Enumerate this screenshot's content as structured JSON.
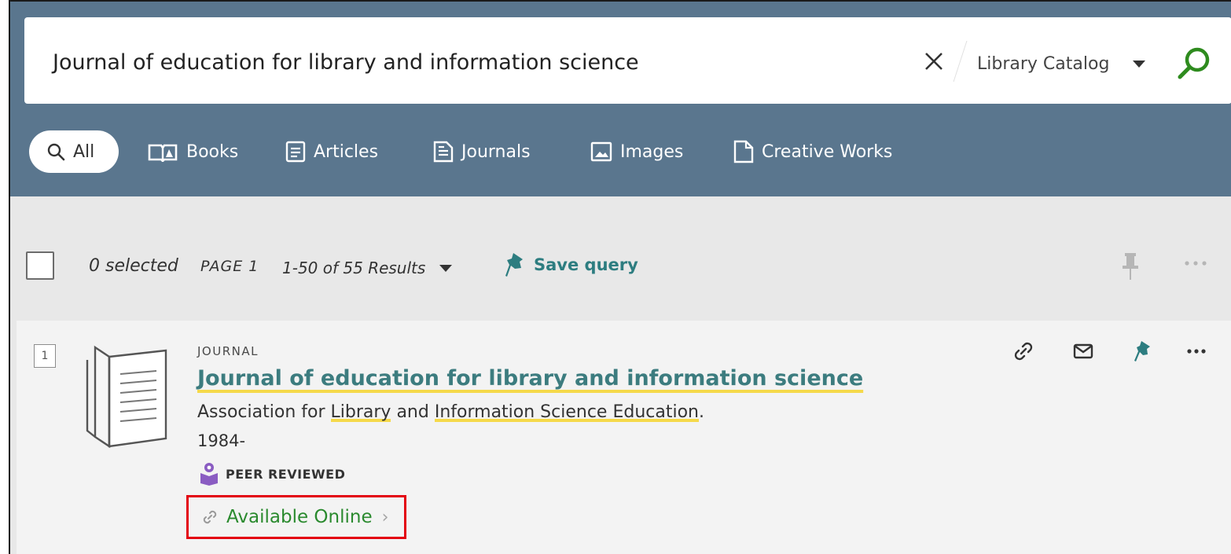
{
  "search": {
    "query": "Journal of education for library and information science",
    "scope": "Library Catalog"
  },
  "tabs": [
    {
      "label": "All",
      "icon": "search-icon"
    },
    {
      "label": "Books",
      "icon": "open-book-icon"
    },
    {
      "label": "Articles",
      "icon": "article-icon"
    },
    {
      "label": "Journals",
      "icon": "journal-icon"
    },
    {
      "label": "Images",
      "icon": "image-icon"
    },
    {
      "label": "Creative Works",
      "icon": "document-icon"
    }
  ],
  "toolbar": {
    "selected": "0 selected",
    "page": "PAGE 1",
    "results": "1-50 of 55 Results",
    "save_query": "Save query"
  },
  "result": {
    "index": "1",
    "type": "JOURNAL",
    "title": "Journal of education for library and information science",
    "author_pre": "Association for ",
    "author_hl1": "Library",
    "author_mid": " and ",
    "author_hl2": "Information Science Education",
    "author_post": ".",
    "date": "1984-",
    "peer_reviewed": "PEER REVIEWED",
    "availability": "Available Online"
  },
  "colors": {
    "header_band": "#5a768e",
    "accent_teal": "#2d7d80",
    "highlight": "#f5d94a",
    "available_green": "#2a8a2e",
    "annotation_red": "#e3000f",
    "peer_purple": "#8a5cc2",
    "search_green": "#2e8b1e"
  }
}
